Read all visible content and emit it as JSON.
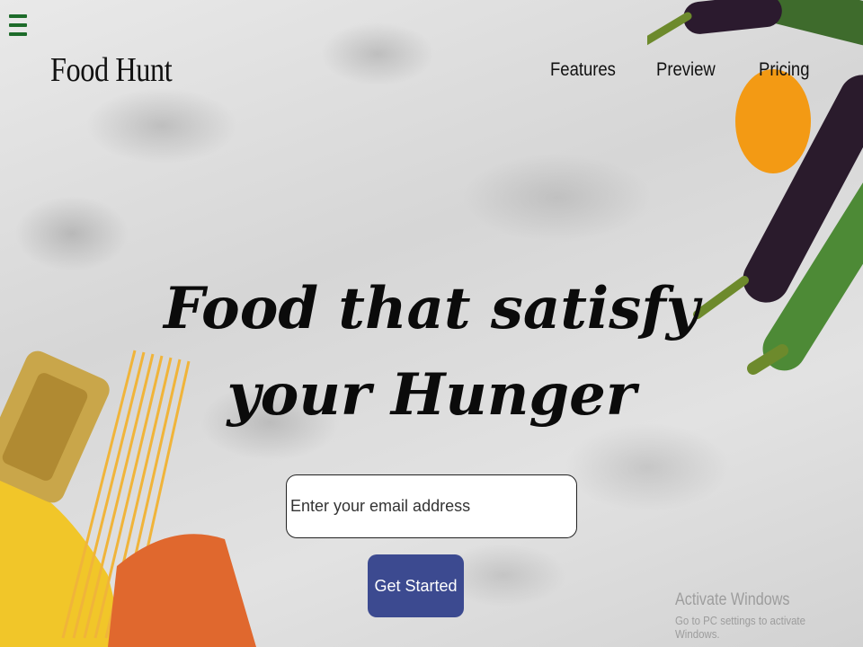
{
  "colors": {
    "menu_icon": "#1d6b2a",
    "primary_button": "#3c4a90",
    "background": "#dcdcdc"
  },
  "header": {
    "menu_icon": "hamburger-menu-icon",
    "brand": "Food Hunt",
    "nav": [
      "Features",
      "Preview",
      "Pricing"
    ]
  },
  "hero": {
    "headline": "Food that satisfy your Hunger"
  },
  "signup": {
    "email_placeholder": "Enter your email address",
    "email_value": "",
    "button_label": "Get Started"
  },
  "watermark": {
    "title": "Activate Windows",
    "subtitle": "Go to PC settings to activate Windows."
  }
}
